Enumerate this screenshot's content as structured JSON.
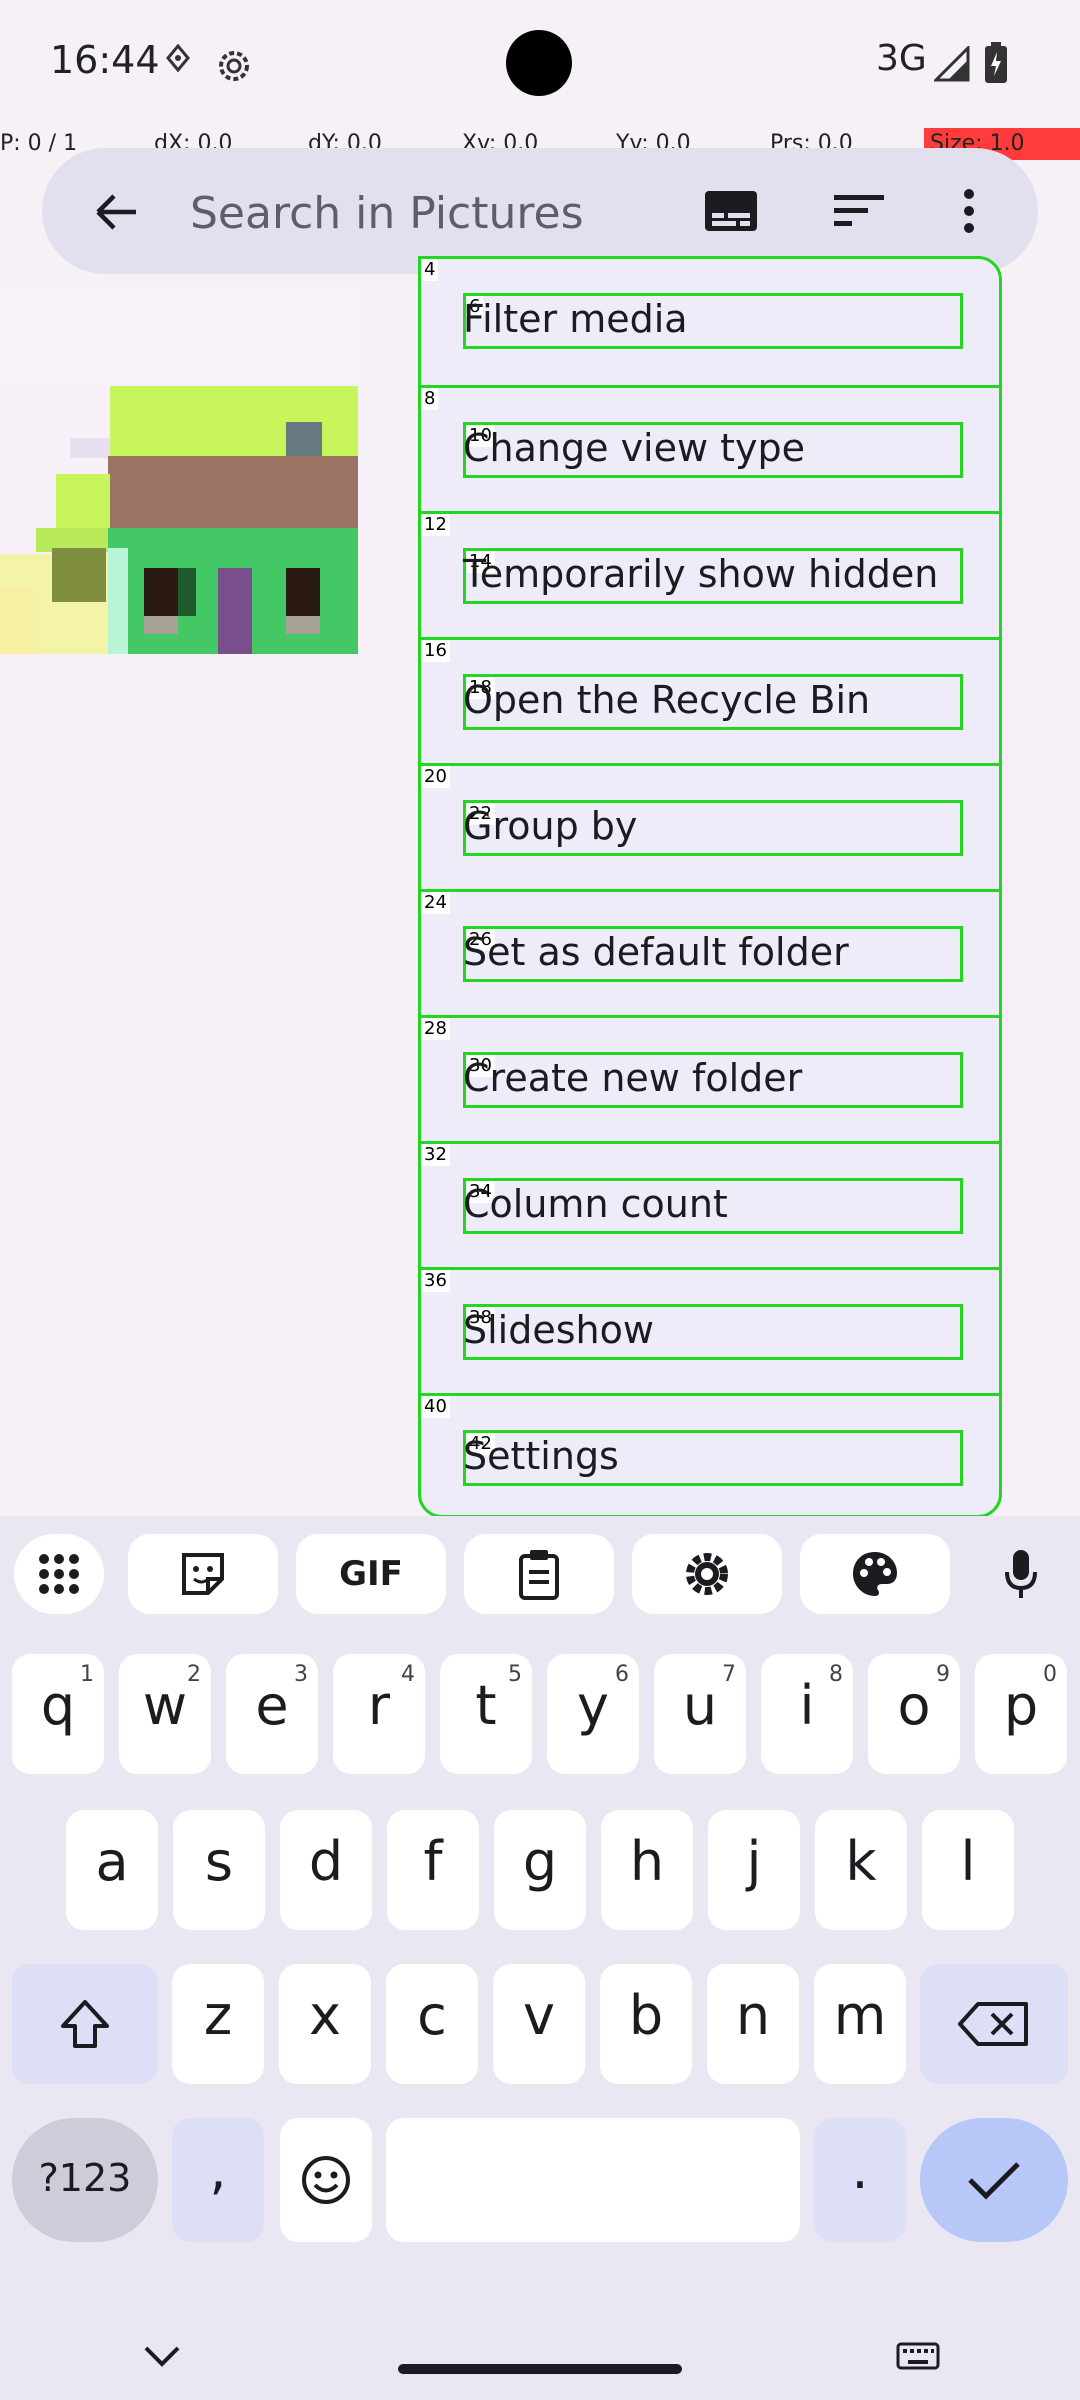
{
  "status_bar": {
    "time": "16:44",
    "network": "3G"
  },
  "pointer_info": {
    "p": "P: 0 / 1",
    "dx": "dX: 0.0",
    "dy": "dY: 0.0",
    "xv": "Xv: 0.0",
    "yv": "Yv: 0.0",
    "prs": "Prs: 0.0",
    "size": "Size: 1.0"
  },
  "search": {
    "placeholder": "Search in Pictures"
  },
  "menu": {
    "items": [
      {
        "label": "Filter media",
        "outer_id": "4",
        "inner_id": "6"
      },
      {
        "label": "Change view type",
        "outer_id": "8",
        "inner_id": "10"
      },
      {
        "label": "Temporarily show hidden",
        "outer_id": "12",
        "inner_id": "14"
      },
      {
        "label": "Open the Recycle Bin",
        "outer_id": "16",
        "inner_id": "18"
      },
      {
        "label": "Group by",
        "outer_id": "20",
        "inner_id": "22"
      },
      {
        "label": "Set as default folder",
        "outer_id": "24",
        "inner_id": "26"
      },
      {
        "label": "Create new folder",
        "outer_id": "28",
        "inner_id": "30"
      },
      {
        "label": "Column count",
        "outer_id": "32",
        "inner_id": "34"
      },
      {
        "label": "Slideshow",
        "outer_id": "36",
        "inner_id": "38"
      },
      {
        "label": "Settings",
        "outer_id": "40",
        "inner_id": "42"
      }
    ]
  },
  "keyboard": {
    "toolbar_gif": "GIF",
    "row1": [
      {
        "k": "q",
        "h": "1"
      },
      {
        "k": "w",
        "h": "2"
      },
      {
        "k": "e",
        "h": "3"
      },
      {
        "k": "r",
        "h": "4"
      },
      {
        "k": "t",
        "h": "5"
      },
      {
        "k": "y",
        "h": "6"
      },
      {
        "k": "u",
        "h": "7"
      },
      {
        "k": "i",
        "h": "8"
      },
      {
        "k": "o",
        "h": "9"
      },
      {
        "k": "p",
        "h": "0"
      }
    ],
    "row2": [
      "a",
      "s",
      "d",
      "f",
      "g",
      "h",
      "j",
      "k",
      "l"
    ],
    "row3": [
      "z",
      "x",
      "c",
      "v",
      "b",
      "n",
      "m"
    ],
    "symbols_label": "?123",
    "comma": ",",
    "period": "."
  },
  "colors": {
    "accent_green": "#22d622",
    "menu_bg": "#edecf8",
    "search_bg": "#e2e0ef",
    "key_tint": "#dcdff5"
  }
}
